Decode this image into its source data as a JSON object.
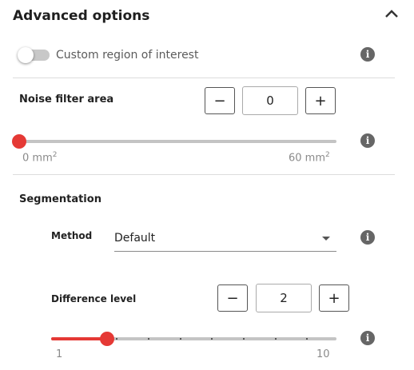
{
  "panel": {
    "title": "Advanced options",
    "collapse_icon": "chevron-up-icon"
  },
  "roi": {
    "label": "Custom region of interest",
    "enabled": false
  },
  "noise_filter": {
    "label": "Noise filter area",
    "decrement_label": "−",
    "increment_label": "+",
    "value": "0",
    "slider": {
      "min_label": "0 mm",
      "max_label": "60 mm",
      "unit_superscript": "2",
      "value_fraction": 0.0
    }
  },
  "segmentation": {
    "heading": "Segmentation",
    "method": {
      "label": "Method",
      "selected": "Default"
    },
    "difference_level": {
      "label": "Difference level",
      "decrement_label": "−",
      "increment_label": "+",
      "value": "2",
      "slider": {
        "min_label": "1",
        "max_label": "10",
        "min": 1,
        "max": 10,
        "value": 2
      }
    }
  },
  "info_glyph": "i",
  "colors": {
    "accent": "#e53935",
    "track": "#c4c4c4",
    "info": "#666666"
  }
}
